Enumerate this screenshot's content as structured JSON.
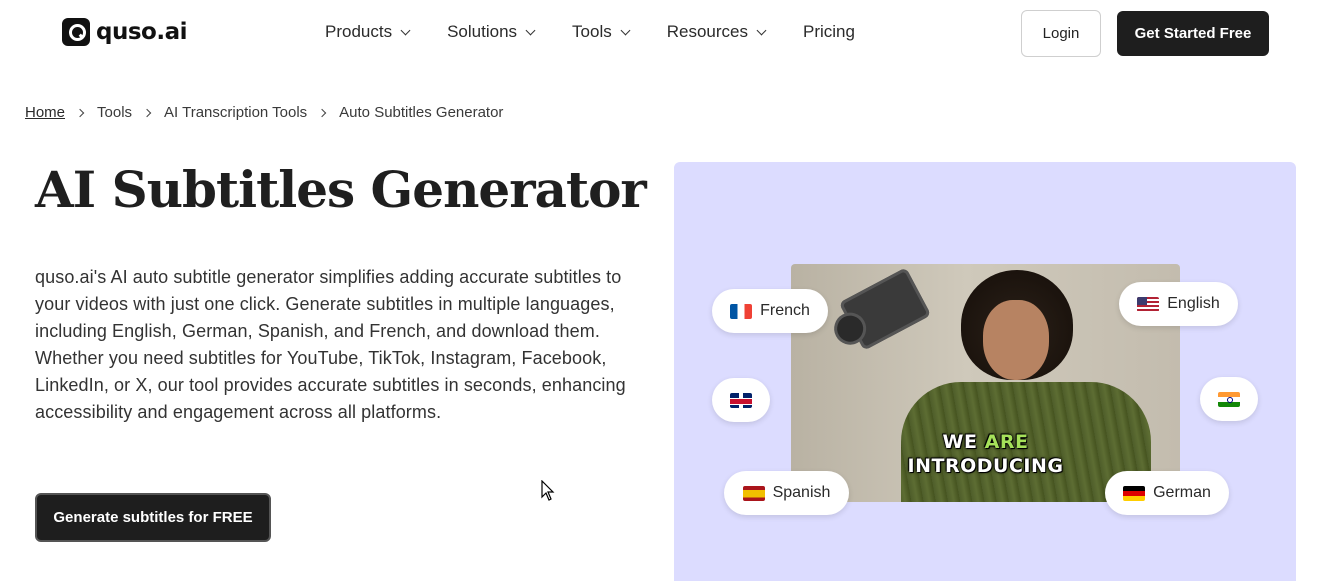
{
  "header": {
    "logo_text": "quso.ai",
    "nav": [
      {
        "label": "Products",
        "has_dropdown": true
      },
      {
        "label": "Solutions",
        "has_dropdown": true
      },
      {
        "label": "Tools",
        "has_dropdown": true
      },
      {
        "label": "Resources",
        "has_dropdown": true
      },
      {
        "label": "Pricing",
        "has_dropdown": false
      }
    ],
    "login_label": "Login",
    "cta_label": "Get Started Free"
  },
  "breadcrumb": [
    "Home",
    "Tools",
    "AI Transcription Tools",
    "Auto Subtitles Generator"
  ],
  "hero": {
    "title": "AI Subtitles Generator",
    "description": "quso.ai's AI auto subtitle generator simplifies adding accurate subtitles to your videos with just one click. Generate subtitles in multiple languages, including English, German, Spanish, and French, and download them. Whether you need subtitles for YouTube, TikTok, Instagram, Facebook, LinkedIn, or X, our tool provides accurate subtitles in seconds, enhancing accessibility and engagement across all platforms.",
    "cta_label": "Generate subtitles for FREE"
  },
  "preview": {
    "caption_line1_a": "WE",
    "caption_line1_b": "ARE",
    "caption_line2": "INTRODUCING",
    "languages": {
      "french": "French",
      "english": "English",
      "spanish": "Spanish",
      "german": "German"
    }
  },
  "colors": {
    "panel_bg": "#dcdcff",
    "button_dark": "#1e1e1e",
    "caption_highlight": "#a6e15a"
  }
}
